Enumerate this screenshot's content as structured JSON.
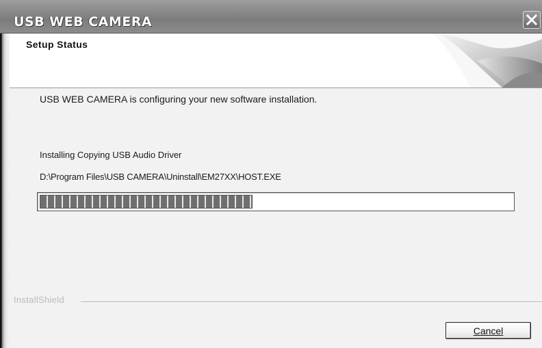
{
  "window": {
    "title": "USB WEB CAMERA",
    "close_icon": "close-icon"
  },
  "header": {
    "title": "Setup Status"
  },
  "content": {
    "intro": "USB WEB CAMERA is configuring your new software installation.",
    "status": "Installing Copying USB Audio Driver",
    "path": "D:\\Program Files\\USB CAMERA\\Uninstall\\EM27XX\\HOST.EXE",
    "progress_fraction": 0.45
  },
  "footer": {
    "brand": "InstallShield",
    "cancel_label": "Cancel"
  },
  "colors": {
    "titlebar": "#8a8a8a",
    "progress": "#6f6f6f",
    "background": "#f2f2f2"
  }
}
